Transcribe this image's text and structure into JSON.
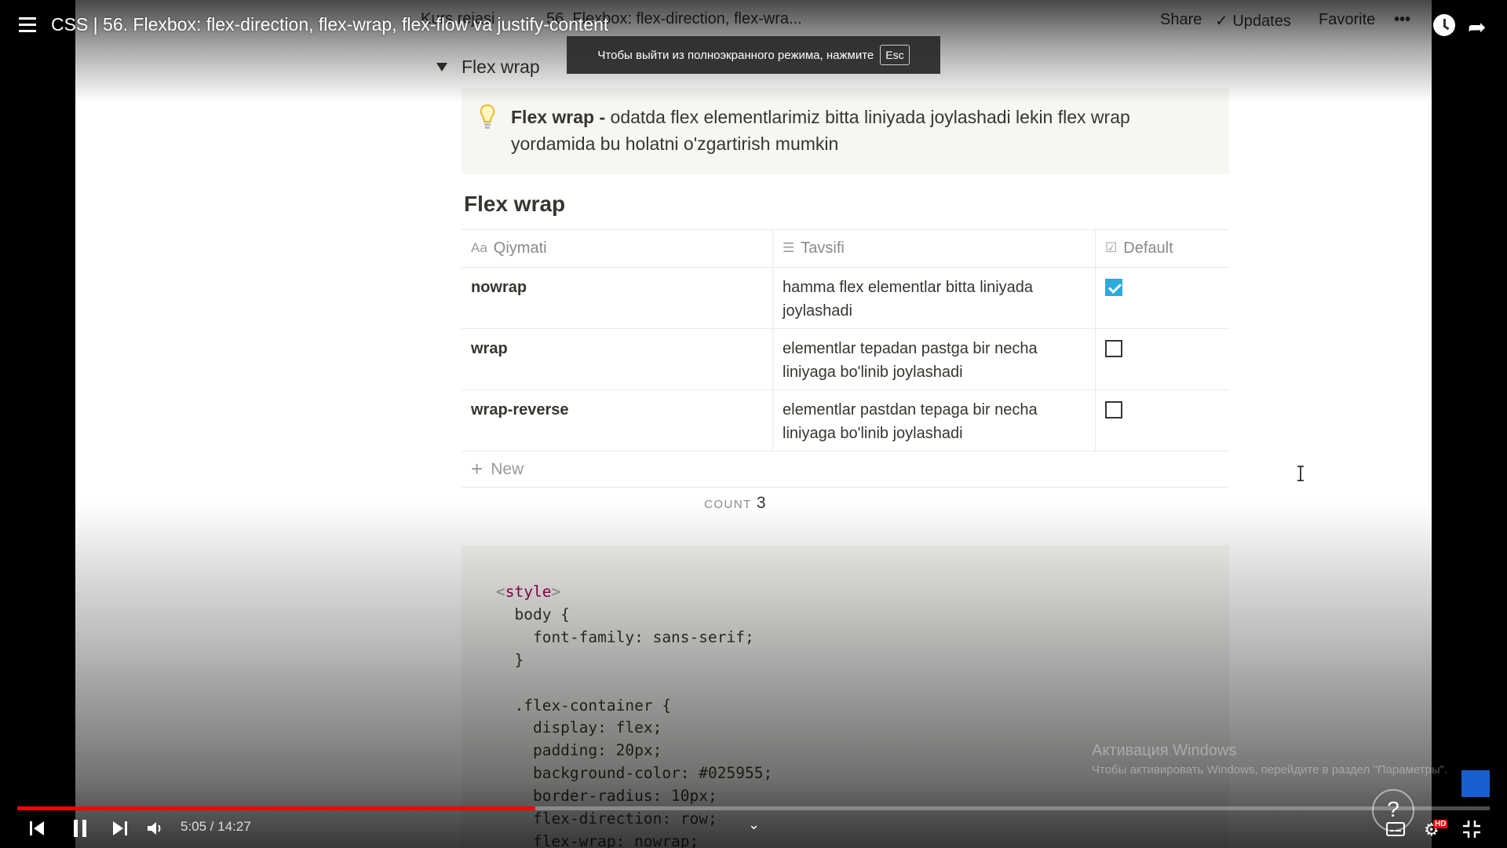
{
  "video": {
    "title": "CSS | 56. Flexbox: flex-direction, flex-wrap, flex-flow va justify-content",
    "current_time": "5:05",
    "duration": "14:27",
    "time_display": "5:05 / 14:27",
    "progress": 0.352,
    "fullscreen_notice": "Чтобы выйти из полноэкранного режима, нажмите",
    "fullscreen_key": "Esc",
    "hd_badge": "HD"
  },
  "notion": {
    "breadcrumbs": [
      "Kurs rejasi",
      "56. Flexbox: flex-direction, flex-wra..."
    ],
    "actions": {
      "share": "Share",
      "updates": "Updates",
      "favorite": "Favorite"
    },
    "toggle_label": "Flex wrap",
    "callout": {
      "bold": "Flex wrap -",
      "text": " odatda flex elementlarimiz bitta liniyada joylashadi lekin flex wrap yordamida bu holatni o'zgartirish mumkin"
    },
    "database": {
      "title": "Flex wrap",
      "columns": [
        "Qiymati",
        "Tavsifi",
        "Default"
      ],
      "rows": [
        {
          "value": "nowrap",
          "desc": "hamma flex elementlar bitta liniyada joylashadi",
          "default": true
        },
        {
          "value": "wrap",
          "desc": "elementlar tepadan pastga bir necha liniyaga bo'linib joylashadi",
          "default": false
        },
        {
          "value": "wrap-reverse",
          "desc": "elementlar pastdan tepaga bir necha liniyaga bo'linib joylashadi",
          "default": false
        }
      ],
      "new_label": "New",
      "count_label": "COUNT",
      "count_value": "3"
    },
    "code": {
      "tag_open": "<",
      "tag_name": "style",
      "tag_close": ">",
      "lines": [
        "  body {",
        "    font-family: sans-serif;",
        "  }",
        "",
        "  .flex-container {",
        "    display: flex;",
        "    padding: 20px;",
        "    background-color: #025955;",
        "    border-radius: 10px;",
        "    flex-direction: row;",
        "    flex-wrap: nowrap;"
      ]
    }
  },
  "windows_activation": {
    "title": "Активация Windows",
    "subtitle": "Чтобы активировать Windows, перейдите в раздел \"Параметры\"."
  },
  "colors": {
    "progress": "#ff0000",
    "checkbox": "#2eaadc",
    "code_tag": "#990055"
  }
}
